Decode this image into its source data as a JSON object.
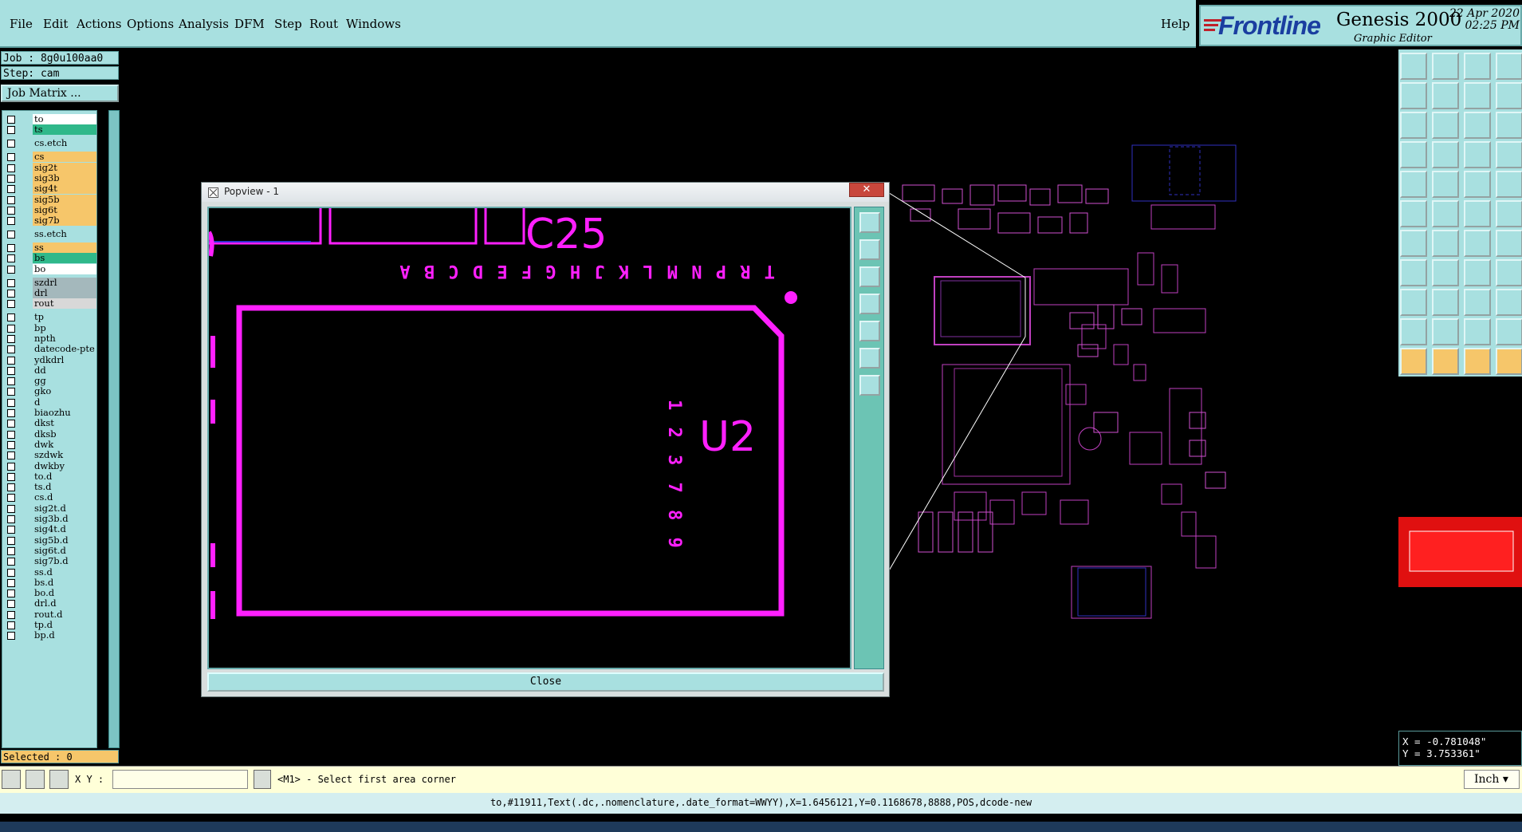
{
  "menu": {
    "items": [
      "File",
      "Edit",
      "Actions",
      "Options",
      "Analysis",
      "DFM",
      "Step",
      "Rout",
      "Windows"
    ],
    "help": "Help"
  },
  "brand": {
    "logo": "Frontline",
    "product": "Genesis 2000",
    "subtitle": "Graphic Editor",
    "date": "22 Apr 2020",
    "time": "02:25 PM"
  },
  "job": {
    "job_label": "Job : 8g0u100aa0",
    "step_label": "Step: cam",
    "matrix_button": "Job Matrix ..."
  },
  "layers": [
    {
      "name": "to",
      "color": "#ffffff"
    },
    {
      "name": "ts",
      "color": "#2fb88a"
    },
    {
      "name": "cs.etch",
      "color": "#a8e0e0"
    },
    {
      "name": "cs",
      "color": "#f6c66a"
    },
    {
      "name": "sig2t",
      "color": "#f6c66a"
    },
    {
      "name": "sig3b",
      "color": "#f6c66a"
    },
    {
      "name": "sig4t",
      "color": "#f6c66a"
    },
    {
      "name": "sig5b",
      "color": "#f6c66a"
    },
    {
      "name": "sig6t",
      "color": "#f6c66a"
    },
    {
      "name": "sig7b",
      "color": "#f6c66a"
    },
    {
      "name": "ss.etch",
      "color": "#a8e0e0"
    },
    {
      "name": "ss",
      "color": "#f6c66a"
    },
    {
      "name": "bs",
      "color": "#2fb88a"
    },
    {
      "name": "bo",
      "color": "#ffffff"
    },
    {
      "name": "szdrl",
      "color": "#a4b8bc"
    },
    {
      "name": "drl",
      "color": "#a4b8bc"
    },
    {
      "name": "rout",
      "color": "#d8d8d8"
    },
    {
      "name": "tp",
      "color": "#a8e0e0"
    },
    {
      "name": "bp",
      "color": "#a8e0e0"
    },
    {
      "name": "npth",
      "color": "#a8e0e0"
    },
    {
      "name": "datecode-pte",
      "color": "#a8e0e0"
    },
    {
      "name": "ydkdrl",
      "color": "#a8e0e0"
    },
    {
      "name": "dd",
      "color": "#a8e0e0"
    },
    {
      "name": "gg",
      "color": "#a8e0e0"
    },
    {
      "name": "gko",
      "color": "#a8e0e0"
    },
    {
      "name": "d",
      "color": "#a8e0e0"
    },
    {
      "name": "biaozhu",
      "color": "#a8e0e0"
    },
    {
      "name": "dkst",
      "color": "#a8e0e0"
    },
    {
      "name": "dksb",
      "color": "#a8e0e0"
    },
    {
      "name": "dwk",
      "color": "#a8e0e0"
    },
    {
      "name": "szdwk",
      "color": "#a8e0e0"
    },
    {
      "name": "dwkby",
      "color": "#a8e0e0"
    },
    {
      "name": "to.d",
      "color": "#a8e0e0"
    },
    {
      "name": "ts.d",
      "color": "#a8e0e0"
    },
    {
      "name": "cs.d",
      "color": "#a8e0e0"
    },
    {
      "name": "sig2t.d",
      "color": "#a8e0e0"
    },
    {
      "name": "sig3b.d",
      "color": "#a8e0e0"
    },
    {
      "name": "sig4t.d",
      "color": "#a8e0e0"
    },
    {
      "name": "sig5b.d",
      "color": "#a8e0e0"
    },
    {
      "name": "sig6t.d",
      "color": "#a8e0e0"
    },
    {
      "name": "sig7b.d",
      "color": "#a8e0e0"
    },
    {
      "name": "ss.d",
      "color": "#a8e0e0"
    },
    {
      "name": "bs.d",
      "color": "#a8e0e0"
    },
    {
      "name": "bo.d",
      "color": "#a8e0e0"
    },
    {
      "name": "drl.d",
      "color": "#a8e0e0"
    },
    {
      "name": "rout.d",
      "color": "#a8e0e0"
    },
    {
      "name": "tp.d",
      "color": "#a8e0e0"
    },
    {
      "name": "bp.d",
      "color": "#a8e0e0"
    }
  ],
  "selected": "Selected : 0",
  "popview": {
    "title": "Popview - 1",
    "close_label": "Close",
    "refdes_top": "C25",
    "refdes_side": "U2",
    "letter_row": "T R P N M L K J H G F E D C B A",
    "number_col": "1 2 3 7 8 9"
  },
  "coords": {
    "x": "X = -0.781048\"",
    "y": "Y = 3.753361\""
  },
  "bottom": {
    "xy_label": "X Y :",
    "xy_value": "",
    "prompt": "<M1> - Select first area corner",
    "units": "Inch"
  },
  "status": "to,#11911,Text(.dc,.nomenclature,.date_format=WWYY),X=1.6456121,Y=0.1168678,8888,POS,dcode-new",
  "colors": {
    "panel": "#a8e0e0",
    "magenta": "#ff20ff",
    "canvas": "#000000",
    "highlight": "#e01010"
  }
}
